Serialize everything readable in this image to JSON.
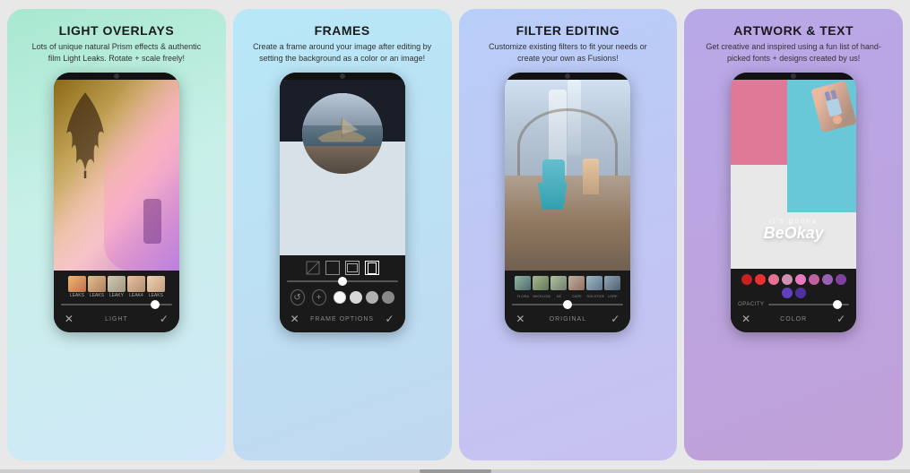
{
  "features": [
    {
      "id": "light-overlays",
      "title": "LIGHT OVERLAYS",
      "description": "Lots of unique natural Prism effects & authentic film Light Leaks. Rotate + scale freely!",
      "bg_gradient": "col-1",
      "phone": {
        "screen_type": "light",
        "bottom_label": "LIGHT",
        "thumbs": [
          "LEAKS",
          "LEAKS",
          "LEAKY",
          "LEAK4",
          "LEAKS"
        ],
        "slider_pos": "85"
      }
    },
    {
      "id": "frames",
      "title": "FRAMES",
      "description": "Create a frame around your image after editing by setting the background as a color or an image!",
      "bg_gradient": "col-2",
      "phone": {
        "screen_type": "frames",
        "bottom_label": "FRAME OPTIONS",
        "circles": [
          "#f0f0f0",
          "#d0d0d0",
          "#b0b0b0",
          "#909090"
        ],
        "slider_pos": "50"
      }
    },
    {
      "id": "filter-editing",
      "title": "FILTER EDITING",
      "description": "Customize existing filters to fit your needs or create your own as Fusions!",
      "bg_gradient": "col-3",
      "phone": {
        "screen_type": "filter",
        "bottom_label": "ORIGINAL",
        "filter_labels": [
          "FLORA",
          "WICKLOW",
          "NZ",
          "CAPE",
          "SOLSTICE",
          "LORE"
        ],
        "slider_pos": "50"
      }
    },
    {
      "id": "artwork-text",
      "title": "ARTWORK & TEXT",
      "description": "Get creative and inspired using a fun list of hand-picked fonts + designs created by us!",
      "bg_gradient": "col-4",
      "phone": {
        "screen_type": "artwork",
        "bottom_label": "COLOR",
        "colors": [
          "#e03030",
          "#c02020",
          "#e07090",
          "#d090b0",
          "#e080c0",
          "#c060a0",
          "#9060b0",
          "#8040a0",
          "#6040c0",
          "#5030a0"
        ],
        "slider_pos": "85",
        "opacity_label": "OPACITY"
      }
    }
  ],
  "ui": {
    "x_icon": "✕",
    "check_icon": "✓",
    "plus_icon": "+",
    "refresh_icon": "↺"
  }
}
